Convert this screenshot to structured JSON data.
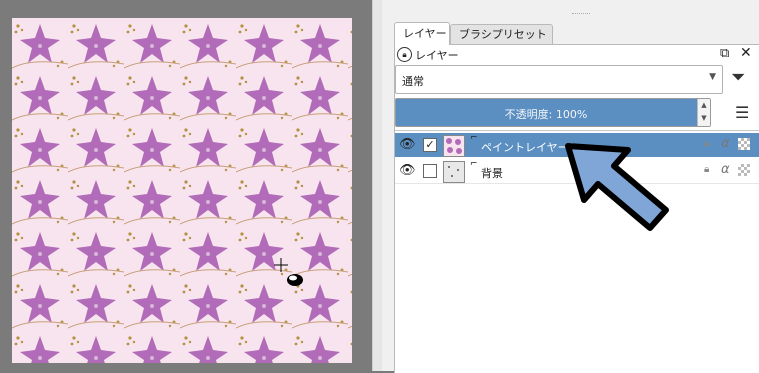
{
  "panel": {
    "tabs": [
      {
        "label": "レイヤー"
      },
      {
        "label": "ブラシプリセット"
      }
    ],
    "docker_title": "レイヤー",
    "blend_mode": "通常",
    "opacity_label": "不透明度: 100%",
    "opacity_percent": 100,
    "layers": [
      {
        "name": "ペイントレイヤー1",
        "selected": true,
        "visible": true,
        "checked": true
      },
      {
        "name": "背景",
        "selected": false,
        "visible": true,
        "checked": false
      }
    ]
  },
  "colors": {
    "canvas_bg": "#f7e4ee",
    "flower": "#b26bb9",
    "dots": "#b49143",
    "selection": "#5b8fc2",
    "arrow": "#7fa6d6"
  },
  "icons": [
    "lock-icon",
    "float-icon",
    "close-icon",
    "filter-icon",
    "menu-icon",
    "eye-icon",
    "lock-alpha-icon",
    "alpha-icon",
    "checker-icon",
    "arrow-icon",
    "cursor-icon"
  ]
}
